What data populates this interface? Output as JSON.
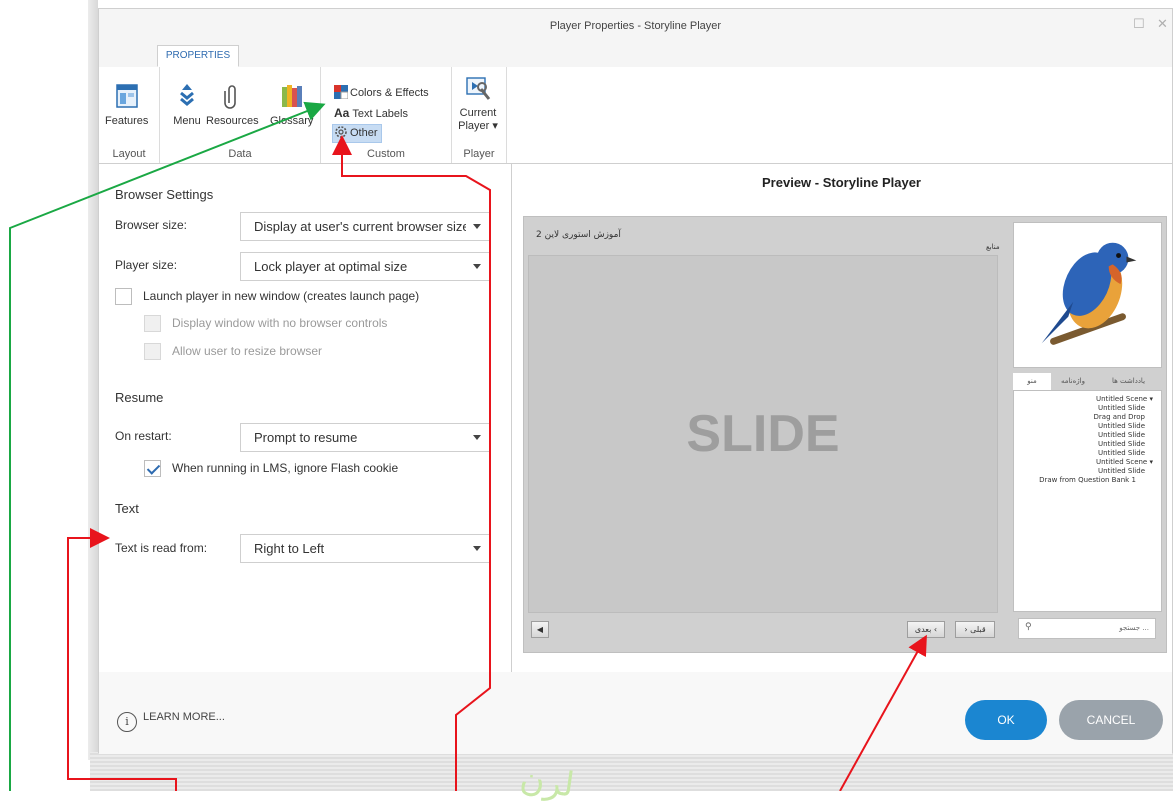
{
  "window": {
    "title": "Player Properties - Storyline Player",
    "tab": "PROPERTIES"
  },
  "ribbon": {
    "layout": {
      "group": "Layout",
      "features": "Features"
    },
    "data": {
      "group": "Data",
      "menu": "Menu",
      "resources": "Resources",
      "glossary": "Glossary"
    },
    "custom": {
      "group": "Custom",
      "colors": "Colors & Effects",
      "text_labels": "Text Labels",
      "other": "Other",
      "text_labels_prefix": "Aa"
    },
    "player": {
      "group": "Player",
      "current_line1": "Current",
      "current_line2": "Player ▾"
    }
  },
  "browser_settings": {
    "heading": "Browser Settings",
    "browser_size_label": "Browser size:",
    "browser_size_value": "Display at user's current browser size",
    "player_size_label": "Player size:",
    "player_size_value": "Lock player at optimal size",
    "launch_new_window": "Launch player in new window (creates launch page)",
    "launch_new_window_checked": false,
    "no_browser_controls": "Display window with no browser controls",
    "allow_resize": "Allow user to resize browser"
  },
  "resume": {
    "heading": "Resume",
    "on_restart_label": "On restart:",
    "on_restart_value": "Prompt to resume",
    "ignore_flash": "When running in LMS, ignore Flash cookie",
    "ignore_flash_checked": true
  },
  "text_section": {
    "heading": "Text",
    "read_from_label": "Text is read from:",
    "read_from_value": "Right to Left"
  },
  "preview": {
    "title": "Preview - Storyline Player",
    "course_title": "آموزش استوری لاین 2",
    "resources_label": "منابع",
    "slide_label": "SLIDE",
    "next_btn": "بعدی",
    "prev_btn": "قبلی",
    "sidebar_tabs": [
      "یادداشت ها",
      "واژه‌نامه",
      "منو"
    ],
    "menu_items": [
      {
        "text": "Untitled Scene",
        "scene": true
      },
      {
        "text": "Untitled Slide",
        "scene": false
      },
      {
        "text": "Drag and Drop",
        "scene": false
      },
      {
        "text": "Untitled Slide",
        "scene": false
      },
      {
        "text": "Untitled Slide",
        "scene": false
      },
      {
        "text": "Untitled Slide",
        "scene": false
      },
      {
        "text": "Untitled Slide",
        "scene": false
      },
      {
        "text": "Untitled Scene",
        "scene": true
      },
      {
        "text": "Untitled Slide",
        "scene": false
      },
      {
        "text": "Draw from Question Bank 1",
        "scene": false
      }
    ],
    "search_placeholder": "جستجو ..."
  },
  "footer": {
    "learn_more": "LEARN MORE...",
    "ok": "OK",
    "cancel": "CANCEL"
  },
  "colors": {
    "accent": "#1b86d1",
    "tab_text": "#2e6bb0",
    "annotation_red": "#e8141c",
    "annotation_green": "#1aa844"
  }
}
